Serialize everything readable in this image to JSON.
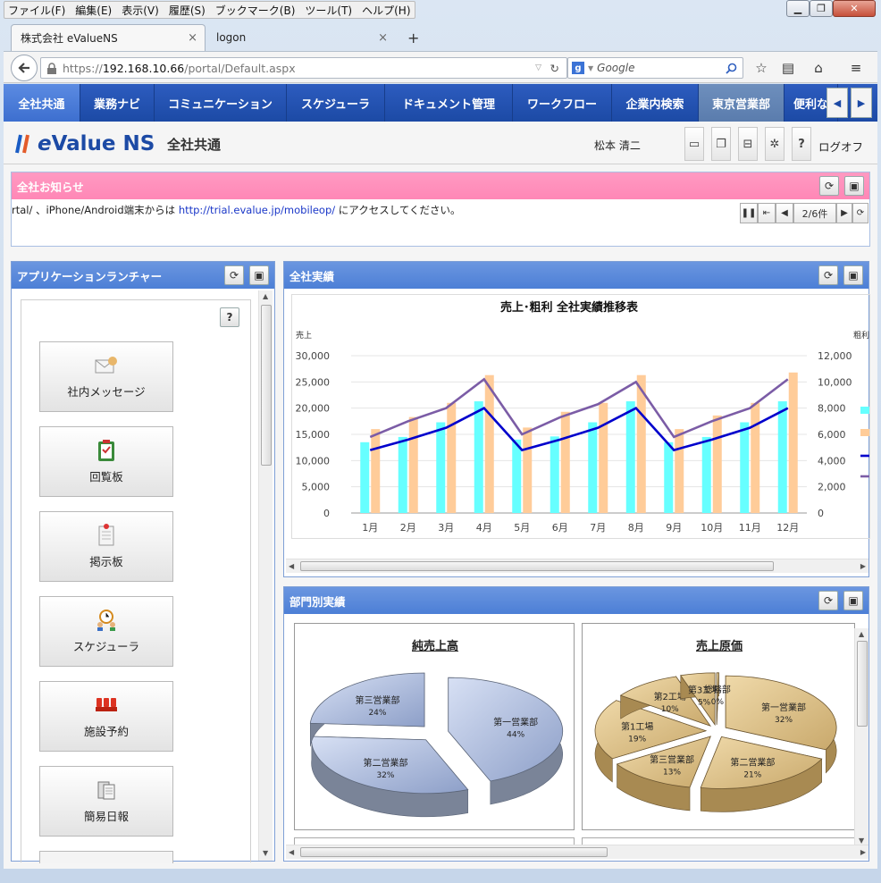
{
  "menu": [
    "ファイル(F)",
    "編集(E)",
    "表示(V)",
    "履歴(S)",
    "ブックマーク(B)",
    "ツール(T)",
    "ヘルプ(H)"
  ],
  "tabs": [
    {
      "label": "株式会社 eValueNS"
    },
    {
      "label": "logon"
    }
  ],
  "tab_close": "×",
  "tab_new": "+",
  "url": {
    "scheme": "https://",
    "host": "192.168.10.66",
    "path": "/portal/Default.aspx"
  },
  "search_placeholder": "Google",
  "app_nav": [
    "全社共通",
    "業務ナビ",
    "コミュニケーション",
    "スケジューラ",
    "ドキュメント管理",
    "ワークフロー",
    "企業内検索",
    "東京営業部",
    "便利な"
  ],
  "logo": {
    "prefix": "e",
    "main": "Value NS"
  },
  "header": {
    "title": "全社共通",
    "user": "松本 清二",
    "logout": "ログオフ",
    "help": "?"
  },
  "notice": {
    "title": "全社お知らせ",
    "text_pre": "rtal/ 、iPhone/Android端末からは ",
    "link": "http://trial.evalue.jp/mobileop/",
    "text_post": " にアクセスしてください。",
    "counter": "2/6件"
  },
  "launcher": {
    "title": "アプリケーションランチャー",
    "help": "?",
    "apps": [
      "社内メッセージ",
      "回覧板",
      "掲示板",
      "スケジューラ",
      "施設予約",
      "簡易日報"
    ]
  },
  "results": {
    "title": "全社実績"
  },
  "dept": {
    "title": "部門別実績"
  },
  "colors": {
    "nav": "#1c4aa5",
    "panel_title": "#4c7fd6",
    "notice_title": "#ff87b6",
    "bar_sales": "#66ffff",
    "bar_profit": "#ffcc99",
    "line_sales": "#0000cc",
    "line_profit": "#7b5ca6"
  },
  "chart_data": [
    {
      "type": "bar",
      "title": "売上･粗利 全社実績推移表",
      "ylabel": "売上",
      "y2label": "粗利",
      "categories": [
        "1月",
        "2月",
        "3月",
        "4月",
        "5月",
        "6月",
        "7月",
        "8月",
        "9月",
        "10月",
        "11月",
        "12月"
      ],
      "ylim": [
        0,
        30000
      ],
      "y2lim": [
        0,
        12000
      ],
      "yticks": [
        "30,000",
        "25,000",
        "20,000",
        "15,000",
        "10,000",
        "5,000",
        "0"
      ],
      "y2ticks": [
        "12,000",
        "10,000",
        "8,000",
        "6,000",
        "4,000",
        "2,000",
        "0"
      ],
      "series": [
        {
          "values": [
            13500,
            14500,
            17300,
            21300,
            14000,
            14600,
            17300,
            21300,
            13500,
            14500,
            17300,
            21300
          ]
        },
        {
          "values": [
            16000,
            18300,
            21000,
            26300,
            16300,
            19300,
            21000,
            26300,
            16000,
            18600,
            21000,
            26800
          ]
        },
        {
          "values": [
            4800,
            5600,
            6500,
            8000,
            4800,
            5600,
            6500,
            8000,
            4800,
            5600,
            6500,
            8000
          ]
        },
        {
          "values": [
            5800,
            7000,
            8000,
            10200,
            6000,
            7300,
            8300,
            10000,
            5800,
            7000,
            8000,
            10200
          ]
        }
      ],
      "grid": true
    },
    {
      "type": "pie",
      "title": "純売上高",
      "slices": [
        {
          "label": "第一営業部",
          "value": 44
        },
        {
          "label": "第二営業部",
          "value": 32
        },
        {
          "label": "第三営業部",
          "value": 24
        }
      ]
    },
    {
      "type": "pie",
      "title": "売上原価",
      "slices": [
        {
          "label": "第一営業部",
          "value": 32
        },
        {
          "label": "第二営業部",
          "value": 21
        },
        {
          "label": "第三営業部",
          "value": 13
        },
        {
          "label": "第1工場",
          "value": 19
        },
        {
          "label": "第2工場",
          "value": 10
        },
        {
          "label": "第3工場",
          "value": 5
        },
        {
          "label": "総務部",
          "value": 0
        }
      ]
    }
  ]
}
